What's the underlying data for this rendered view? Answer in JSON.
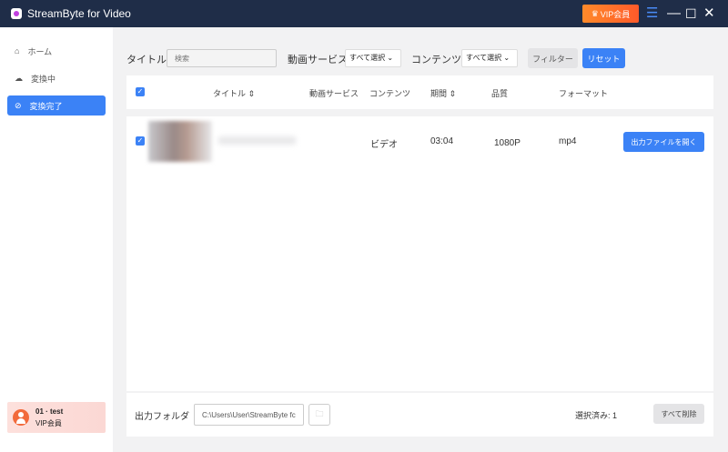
{
  "app": {
    "title": "StreamByte for Video",
    "vip_label": "VIP会員"
  },
  "sidebar": {
    "items": [
      {
        "label": "ホーム",
        "icon": "home-icon"
      },
      {
        "label": "変換中",
        "icon": "cloud-download-icon"
      },
      {
        "label": "変換完了",
        "icon": "check-circle-icon",
        "active": true
      }
    ],
    "user": {
      "name": "01 · test",
      "plan": "VIP会員"
    }
  },
  "filters": {
    "title_label": "タイトル",
    "search_placeholder": "検索",
    "service_label": "動画サービス",
    "service_value": "すべて選択",
    "content_label": "コンテンツ",
    "content_value": "すべて選択",
    "filter_button": "フィルター",
    "reset_button": "リセット"
  },
  "table": {
    "headers": {
      "title": "タイトル",
      "service": "動画サービス",
      "content": "コンテンツ",
      "duration": "期間",
      "quality": "品質",
      "format": "フォーマット"
    },
    "rows": [
      {
        "checked": true,
        "content": "ビデオ",
        "duration": "03:04",
        "quality": "1080P",
        "format": "mp4",
        "action": "出力ファイルを開く"
      }
    ]
  },
  "footer": {
    "output_label": "出力フォルダ",
    "output_path": "C:\\Users\\User\\StreamByte fc",
    "selected_label": "選択済み: 1",
    "delete_all": "すべて削除"
  },
  "colors": {
    "accent": "#3b82f6",
    "titlebar": "#1f2d48",
    "vip": "#ff6a2a"
  }
}
